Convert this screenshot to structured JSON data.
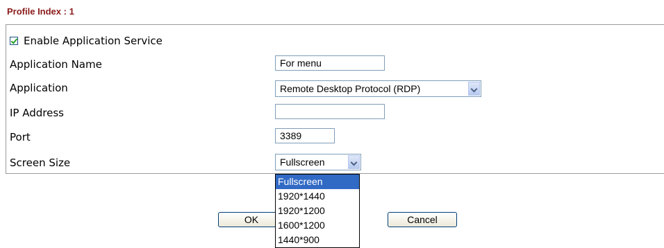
{
  "header": {
    "title": "Profile Index : 1"
  },
  "form": {
    "enable_label": "Enable Application Service",
    "enable_checked": true,
    "app_name_label": "Application Name",
    "app_name_value": "For menu",
    "application_label": "Application",
    "application_value": "Remote Desktop Protocol (RDP)",
    "ip_label": "IP Address",
    "ip_value": "",
    "port_label": "Port",
    "port_value": "3389",
    "screen_size_label": "Screen Size",
    "screen_size_value": "Fullscreen"
  },
  "screen_size_options": [
    "Fullscreen",
    "1920*1440",
    "1920*1200",
    "1600*1200",
    "1440*900"
  ],
  "selected_option_index": 0,
  "buttons": {
    "ok": "OK",
    "cancel": "Cancel"
  },
  "colors": {
    "title": "#8b1a1a",
    "selection": "#316ac5"
  }
}
